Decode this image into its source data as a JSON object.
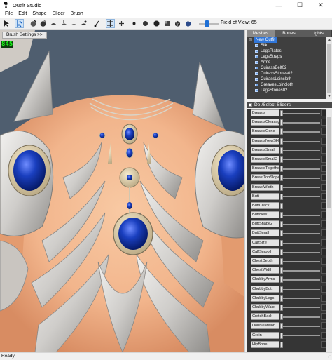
{
  "window": {
    "title": "Outfit Studio",
    "controls": {
      "minimize": "—",
      "maximize": "☐",
      "close": "✕"
    }
  },
  "menu": [
    "File",
    "Edit",
    "Shape",
    "Slider",
    "Brush"
  ],
  "toolbar": {
    "field_of_view_label": "Field of View: 65",
    "field_of_view": 65,
    "icons": [
      "select-brush-icon",
      "transform-icon",
      "mask-brush-icon",
      "inflate-brush-icon",
      "deflate-brush-icon",
      "move-brush-icon",
      "smooth-brush-icon",
      "weight-brush-icon",
      "color-brush-icon",
      "alpha-brush-icon",
      "collision-icon",
      "symmetry-icon",
      "wireframe-icon",
      "lighting-icon",
      "texture-icon",
      "vertex-color-icon",
      "cube-icon"
    ]
  },
  "viewport": {
    "brush_settings_label": "Brush Settings >>",
    "fps": "845"
  },
  "panel": {
    "tabs": [
      "Meshes",
      "Bones",
      "Lights"
    ],
    "active_tab": "Meshes",
    "outfit_root": "New Outfit",
    "meshes": [
      "Silk",
      "LegsPlates",
      "LegsStraps",
      "Arms",
      "CuirassBelt02",
      "CuirassStones02",
      "CuirassLoincloth",
      "GreavesLoincloth",
      "LegsStones02"
    ],
    "slider_header": "De-/Select Sliders",
    "sliders": [
      {
        "name": "Breasts",
        "value": 0.0
      },
      {
        "name": "BreastsCleavage",
        "value": 0.0
      },
      {
        "name": "BreastsGone",
        "value": 0.0
      },
      {
        "name": "BreastsNewSH",
        "value": 0.0
      },
      {
        "name": "BreastsSmall",
        "value": 0.0
      },
      {
        "name": "BreastsSmall2",
        "value": 0.0
      },
      {
        "name": "BreastsTogether",
        "value": 0.0
      },
      {
        "name": "BreastTopSlope",
        "value": 0.0
      },
      {
        "name": "BreastWidth",
        "value": 0.0
      },
      {
        "name": "Butt",
        "value": 0.0
      },
      {
        "name": "ButtCrack",
        "value": 0.0
      },
      {
        "name": "ButtNew",
        "value": 0.0
      },
      {
        "name": "ButtShape2",
        "value": 0.0
      },
      {
        "name": "ButtSmall",
        "value": 0.0
      },
      {
        "name": "CalfSize",
        "value": 0.0
      },
      {
        "name": "CalfSmooth",
        "value": 0.0
      },
      {
        "name": "ChestDepth",
        "value": 0.0
      },
      {
        "name": "ChestWidth",
        "value": 0.0
      },
      {
        "name": "ChubbyArms",
        "value": 0.0
      },
      {
        "name": "ChubbyButt",
        "value": 0.0
      },
      {
        "name": "ChubbyLegs",
        "value": 0.0
      },
      {
        "name": "ChubbyWaist",
        "value": 0.0
      },
      {
        "name": "CrotchBack",
        "value": 0.0
      },
      {
        "name": "DoubleMelon",
        "value": 0.0
      },
      {
        "name": "Groin",
        "value": 0.0
      },
      {
        "name": "HipBone",
        "value": 0.0
      }
    ]
  },
  "status": {
    "text": "Ready!"
  },
  "colors": {
    "viewport_bg": "#4f5e6f",
    "skin": "#f2b58c",
    "armor_silver": "#d8d6d3",
    "gem_blue": "#1a3fbf",
    "selection": "#3076d9",
    "fps_green": "#18ff18"
  }
}
